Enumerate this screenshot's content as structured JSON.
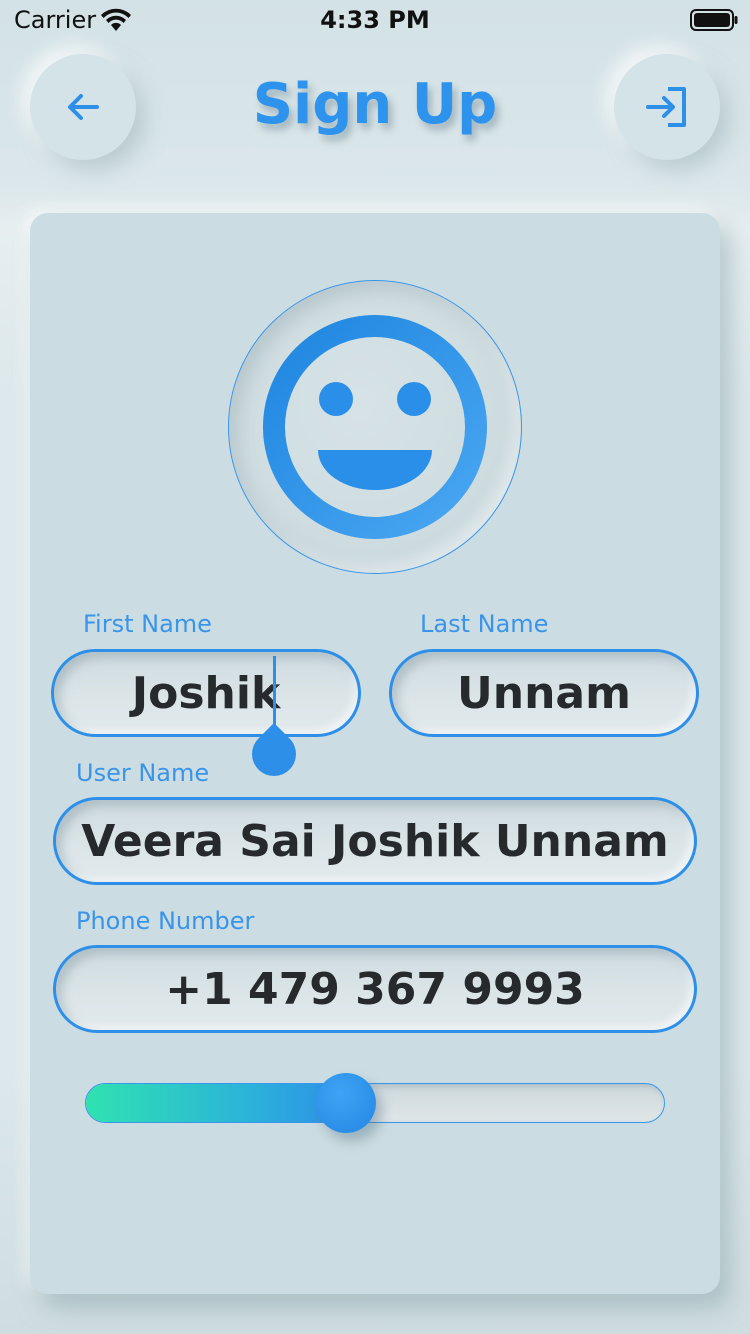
{
  "status_bar": {
    "carrier": "Carrier",
    "time": "4:33 PM"
  },
  "header": {
    "title": "Sign Up",
    "back_icon": "arrow-left-icon",
    "login_icon": "sign-in-icon"
  },
  "avatar": {
    "icon": "smiley-face-icon"
  },
  "form": {
    "first_name": {
      "label": "First Name",
      "value": "Joshik"
    },
    "last_name": {
      "label": "Last Name",
      "value": "Unnam"
    },
    "user_name": {
      "label": "User Name",
      "value": "Veera Sai Joshik Unnam"
    },
    "phone": {
      "label": "Phone Number",
      "value": "+1 479 367 9993"
    }
  },
  "slider": {
    "value": 0.45
  },
  "colors": {
    "accent": "#2e8fe8",
    "background": "#dce8eb",
    "text": "#262a2d",
    "slider_start": "#2fe2b0"
  }
}
